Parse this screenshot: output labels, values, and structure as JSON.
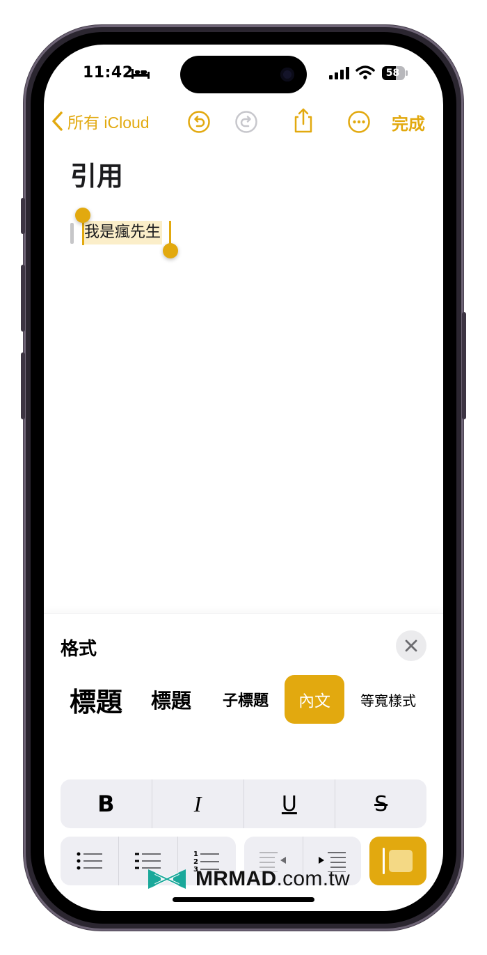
{
  "status_bar": {
    "time": "11:42",
    "battery": "58",
    "icons": [
      "bed-icon",
      "signal-icon",
      "wifi-icon",
      "battery-icon"
    ]
  },
  "nav": {
    "back_label": "所有 iCloud",
    "done_label": "完成",
    "icons": [
      "chevron-left-icon",
      "undo-icon",
      "redo-icon",
      "share-icon",
      "more-icon"
    ]
  },
  "note": {
    "title": "引用",
    "selected_text": "我是瘋先生"
  },
  "format_panel": {
    "title": "格式",
    "styles": {
      "title": "標題",
      "heading": "標題",
      "subheading": "子標題",
      "body": "內文",
      "monospaced": "等寬樣式"
    },
    "selected_style": "內文",
    "text_styles": {
      "bold": "B",
      "italic": "I",
      "underline": "U",
      "strikethrough": "S"
    },
    "list_buttons": [
      "bulleted-list-icon",
      "dashed-list-icon",
      "numbered-list-icon"
    ],
    "numbered_list_digits": [
      "1",
      "2",
      "3"
    ],
    "indent_buttons": [
      "outdent-icon",
      "indent-icon"
    ],
    "block_quote": "block-quote-icon"
  },
  "watermark": {
    "brand": "MRMAD",
    "domain": ".com.tw"
  },
  "colors": {
    "accent": "#e2a90f",
    "selection": "#fbeec9",
    "panel_button_bg": "#eeeef3",
    "watermark_logo": "#1aa89a"
  }
}
